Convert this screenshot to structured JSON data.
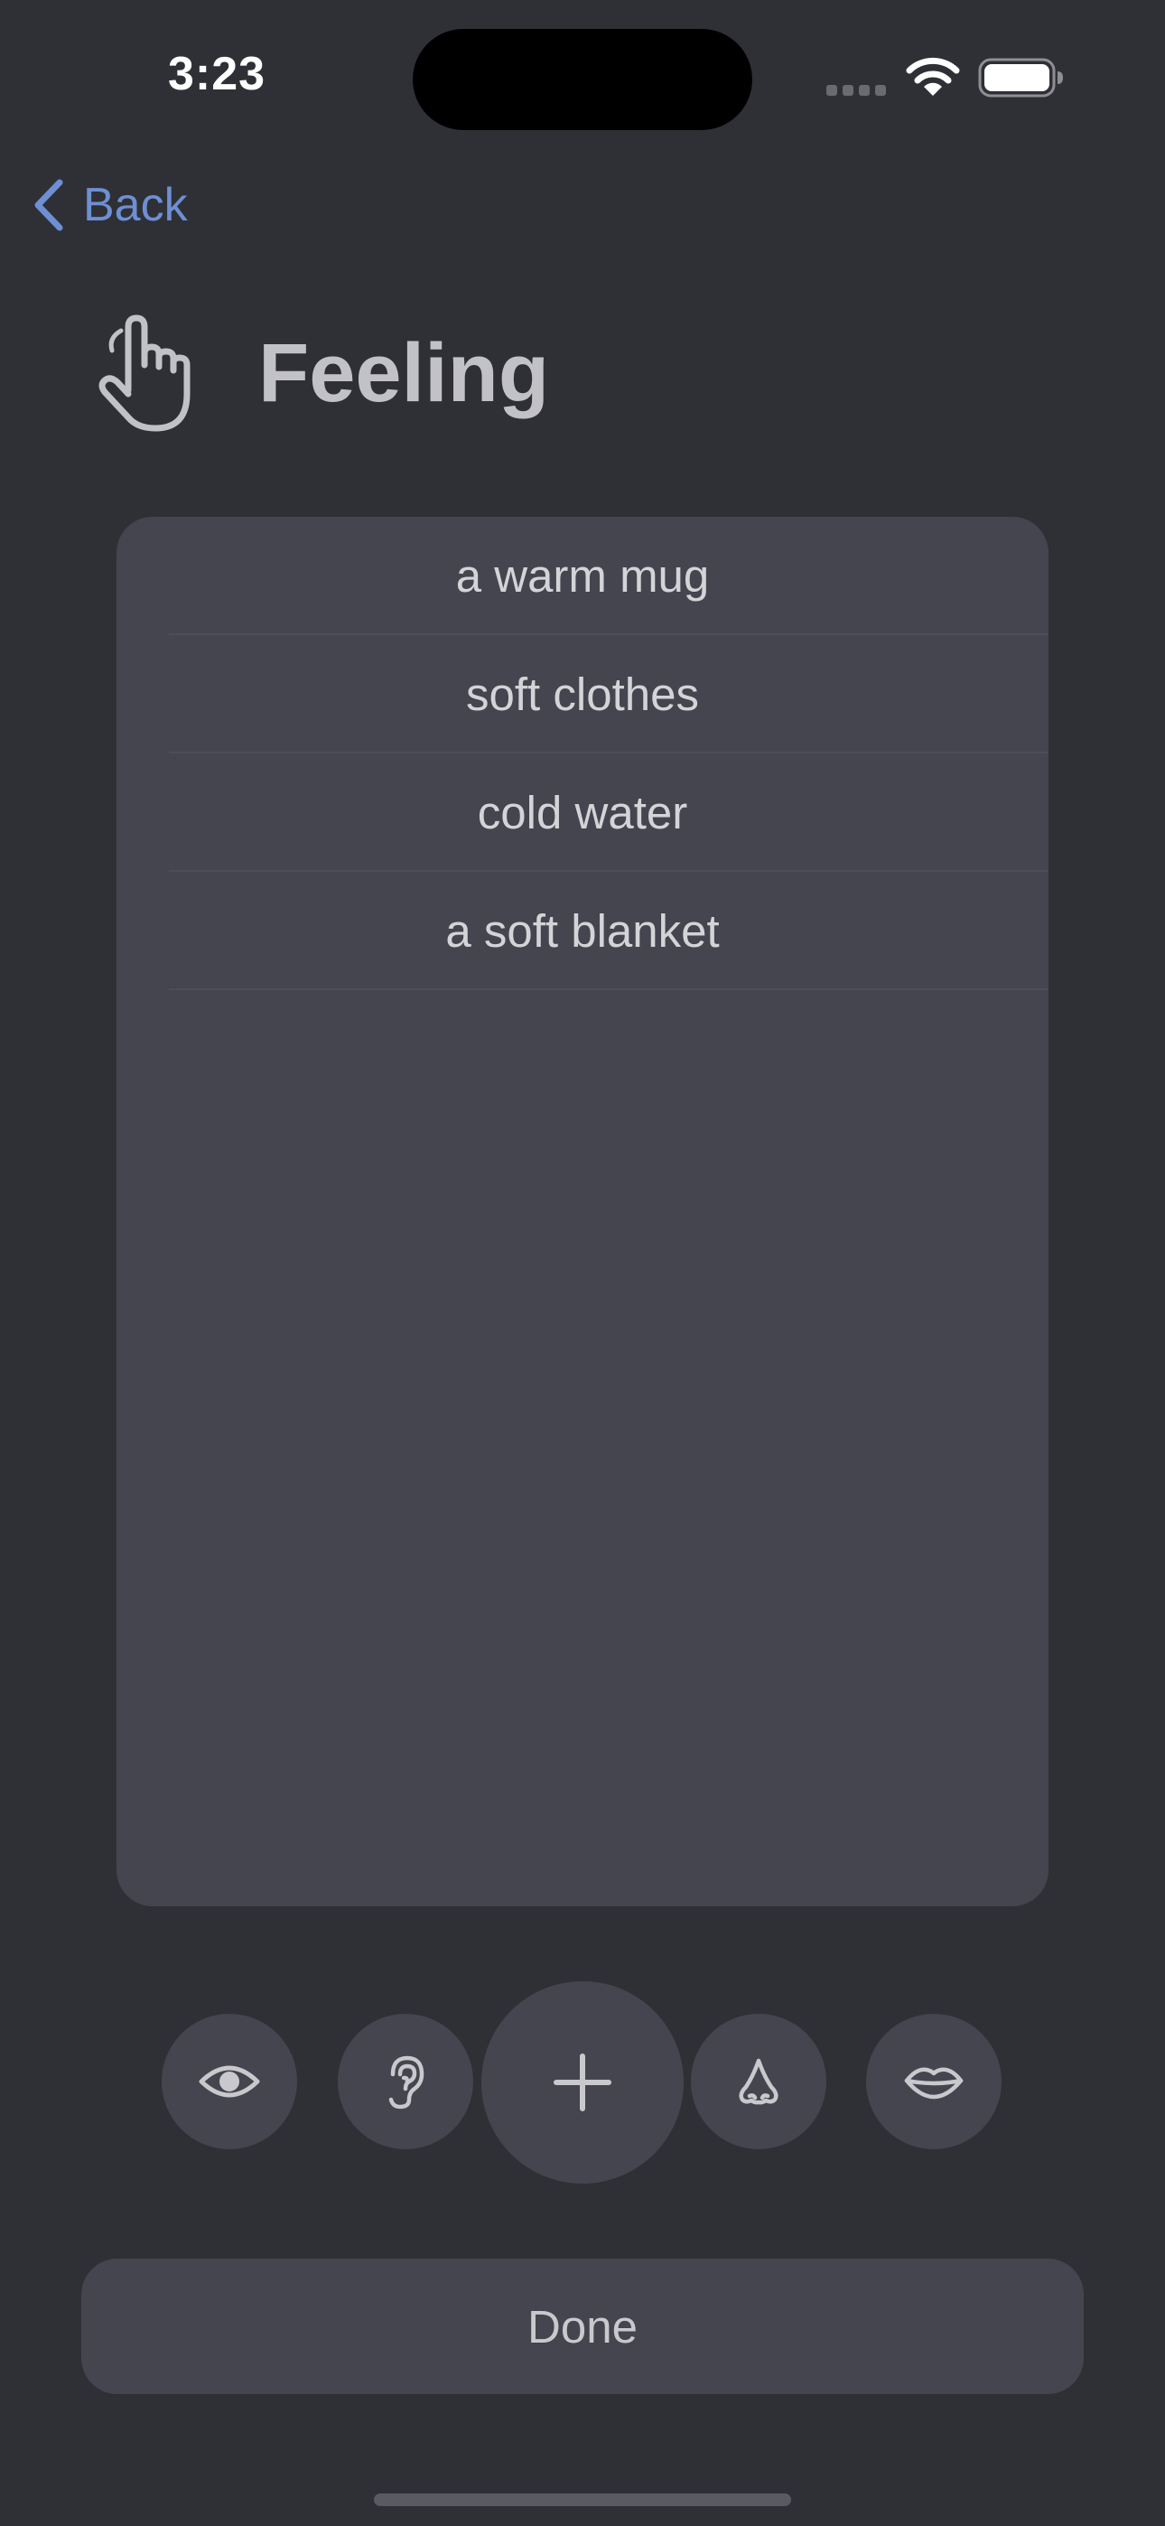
{
  "status_bar": {
    "time": "3:23"
  },
  "nav": {
    "back_label": "Back",
    "accent_color": "#6e8fd3"
  },
  "header": {
    "icon": "hand-point-up-icon",
    "title": "Feeling"
  },
  "list": {
    "items": [
      "a warm mug",
      "soft clothes",
      "cold water",
      "a soft blanket"
    ]
  },
  "sense_bar": {
    "buttons": [
      {
        "icon": "eye-icon",
        "sense": "sight"
      },
      {
        "icon": "ear-icon",
        "sense": "hearing"
      },
      {
        "icon": "plus-icon",
        "sense": "add"
      },
      {
        "icon": "nose-icon",
        "sense": "smell"
      },
      {
        "icon": "lips-icon",
        "sense": "taste"
      }
    ]
  },
  "footer": {
    "done_label": "Done"
  },
  "colors": {
    "background": "#2f3036",
    "card": "#45454f",
    "text": "#c9c9cd"
  }
}
